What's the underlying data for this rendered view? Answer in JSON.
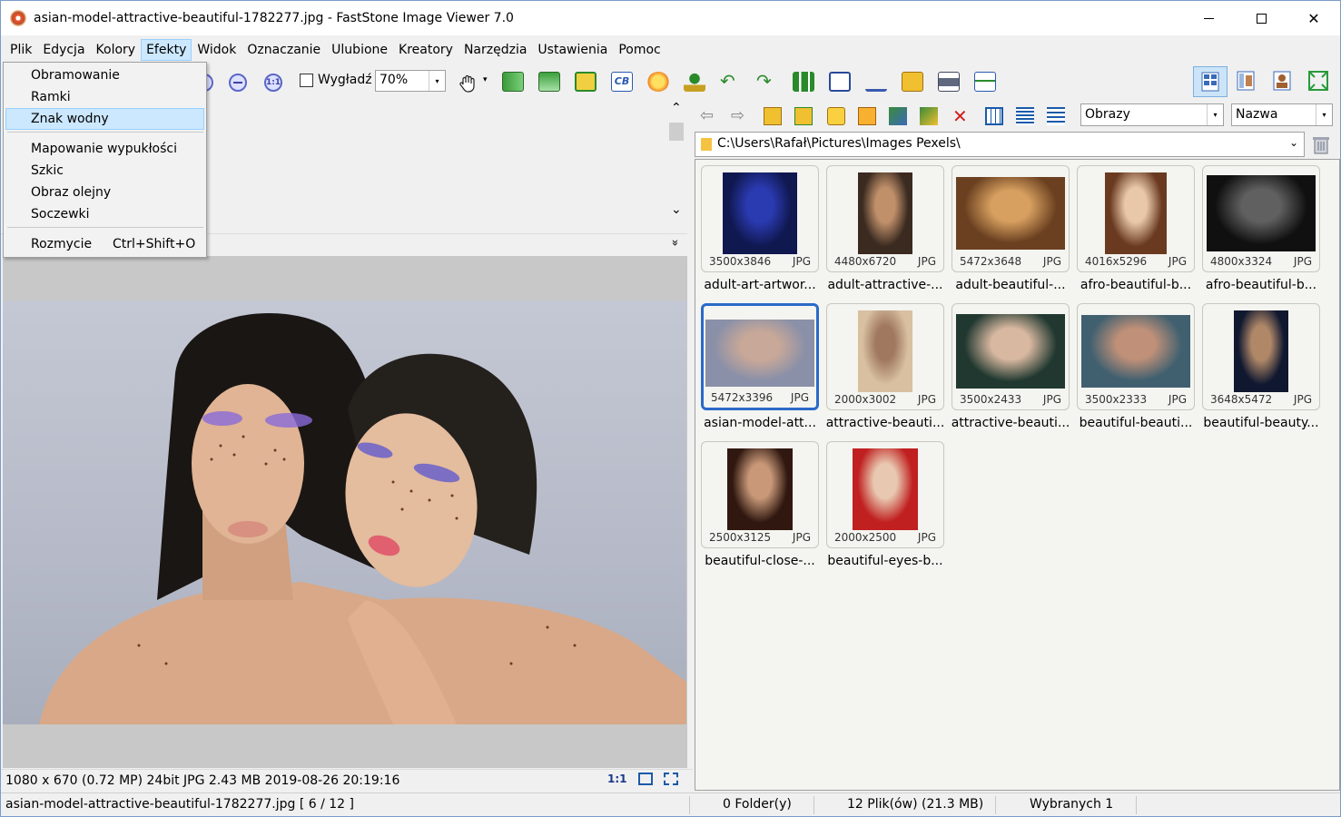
{
  "window": {
    "title": "asian-model-attractive-beautiful-1782277.jpg  -  FastStone Image Viewer 7.0",
    "minimize": "—",
    "maximize": "□",
    "close": "✕"
  },
  "menubar": {
    "items": [
      "Plik",
      "Edycja",
      "Kolory",
      "Efekty",
      "Widok",
      "Oznaczanie",
      "Ulubione",
      "Kreatory",
      "Narzędzia",
      "Ustawienia",
      "Pomoc"
    ],
    "active": "Efekty"
  },
  "dropdown": {
    "items": [
      {
        "label": "Obramowanie"
      },
      {
        "label": "Ramki"
      },
      {
        "label": "Znak wodny",
        "highlighted": true
      },
      {
        "label": "Mapowanie wypukłości"
      },
      {
        "label": "Szkic"
      },
      {
        "label": "Obraz olejny"
      },
      {
        "label": "Soczewki"
      },
      {
        "label": "Rozmycie",
        "shortcut": "Ctrl+Shift+O"
      }
    ]
  },
  "toolbar": {
    "actual_size_icon_text": "1:1",
    "smooth_label": "Wygładź",
    "smooth_checked": false,
    "zoom_value": "70%",
    "zoom_arrow": "▾",
    "pan_arrow": "▾"
  },
  "viewer": {
    "collapse_glyph": "»",
    "scroll_up": "⌃",
    "scroll_down": "⌄"
  },
  "image_info": {
    "text": "1080 x 670 (0.72 MP)  24bit  JPG   2.43 MB   2019-08-26 20:19:16",
    "actual_size": "1:1"
  },
  "browser": {
    "filter": "Obrazy",
    "sort": "Nazwa",
    "select_arrow": "▾",
    "path": "C:\\Users\\Rafał\\Pictures\\Images Pexels\\",
    "path_chevron": "⌄",
    "thumbnails": [
      {
        "dims": "3500x3846",
        "ext": "JPG",
        "name": "adult-art-artwor...",
        "colors": [
          "#101850",
          "#2a3ab0"
        ]
      },
      {
        "dims": "4480x6720",
        "ext": "JPG",
        "name": "adult-attractive-...",
        "colors": [
          "#3a2a20",
          "#c0906a"
        ]
      },
      {
        "dims": "5472x3648",
        "ext": "JPG",
        "name": "adult-beautiful-...",
        "colors": [
          "#6a4020",
          "#d8a060"
        ]
      },
      {
        "dims": "4016x5296",
        "ext": "JPG",
        "name": "afro-beautiful-b...",
        "colors": [
          "#6a3a20",
          "#e8c8a8"
        ]
      },
      {
        "dims": "4800x3324",
        "ext": "JPG",
        "name": "afro-beautiful-b...",
        "colors": [
          "#101010",
          "#606060"
        ]
      },
      {
        "dims": "5472x3396",
        "ext": "JPG",
        "name": "asian-model-att...",
        "colors": [
          "#8a90a8",
          "#c8a898"
        ],
        "selected": true
      },
      {
        "dims": "2000x3002",
        "ext": "JPG",
        "name": "attractive-beauti...",
        "colors": [
          "#d8c0a0",
          "#a07860"
        ]
      },
      {
        "dims": "3500x2433",
        "ext": "JPG",
        "name": "attractive-beauti...",
        "colors": [
          "#203830",
          "#d8b8a0"
        ]
      },
      {
        "dims": "3500x2333",
        "ext": "JPG",
        "name": "beautiful-beauti...",
        "colors": [
          "#406070",
          "#c09078"
        ]
      },
      {
        "dims": "3648x5472",
        "ext": "JPG",
        "name": "beautiful-beauty...",
        "colors": [
          "#101830",
          "#b08868"
        ]
      },
      {
        "dims": "2500x3125",
        "ext": "JPG",
        "name": "beautiful-close-...",
        "colors": [
          "#301810",
          "#c89878"
        ]
      },
      {
        "dims": "2000x2500",
        "ext": "JPG",
        "name": "beautiful-eyes-b...",
        "colors": [
          "#c02020",
          "#e8c8b0"
        ]
      }
    ]
  },
  "statusbar": {
    "file": "asian-model-attractive-beautiful-1782277.jpg [ 6 / 12 ]",
    "folders": "0 Folder(y)",
    "files": "12 Plik(ów) (21.3 MB)",
    "selected": "Wybranych 1"
  },
  "colors": {
    "accent": "#2a6ac8",
    "menu_highlight": "#cce8ff",
    "eyeshadow": "#8a6ad8"
  }
}
